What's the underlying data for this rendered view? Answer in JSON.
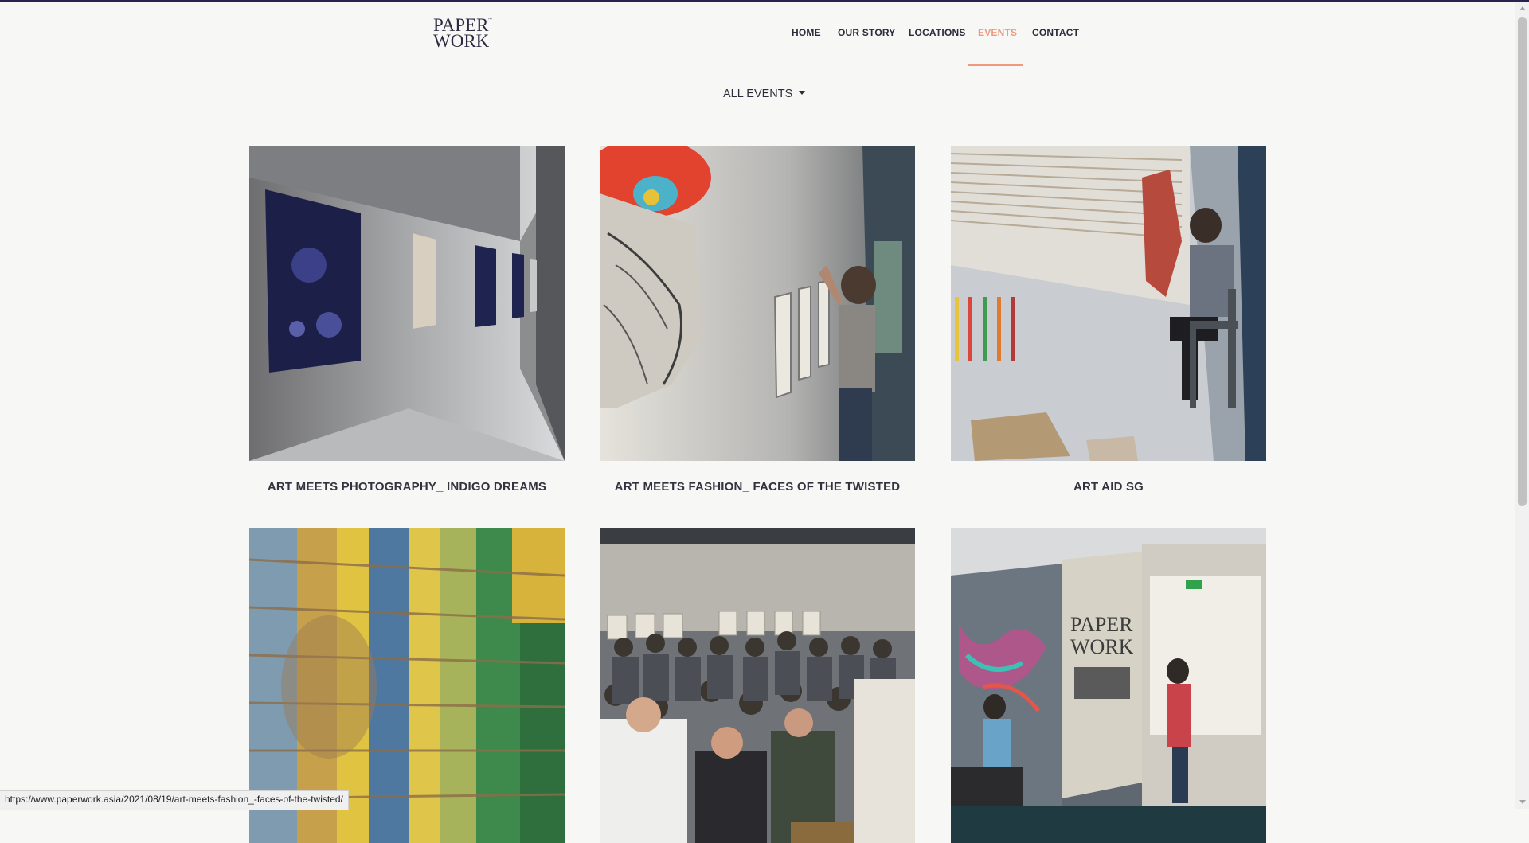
{
  "brand": {
    "logo_line1": "PAPER",
    "logo_line2": "WORK",
    "logo_tm": "™",
    "color_nav": "#2b2b3a",
    "color_accent": "#ef9a7d"
  },
  "nav": {
    "items": [
      {
        "label": "HOME",
        "active": false
      },
      {
        "label": "OUR STORY",
        "active": false
      },
      {
        "label": "LOCATIONS",
        "active": false
      },
      {
        "label": "EVENTS",
        "active": true
      },
      {
        "label": "CONTACT",
        "active": false
      }
    ]
  },
  "filter": {
    "label": "ALL EVENTS",
    "icon": "caret-down-icon"
  },
  "events": [
    {
      "title": "ART MEETS PHOTOGRAPHY_ INDIGO DREAMS",
      "image": "gallery-hallway-photo"
    },
    {
      "title": "ART MEETS FASHION_ FACES OF THE TWISTED",
      "image": "artist-hanging-frames-photo"
    },
    {
      "title": "ART AID SG",
      "image": "artist-mural-photo"
    },
    {
      "title": "",
      "image": "woven-wall-art-photo"
    },
    {
      "title": "",
      "image": "audience-gathering-photo"
    },
    {
      "title": "",
      "image": "paperwork-lobby-photo"
    }
  ],
  "status_bar": {
    "url": "https://www.paperwork.asia/2021/08/19/art-meets-fashion_-faces-of-the-twisted/"
  }
}
